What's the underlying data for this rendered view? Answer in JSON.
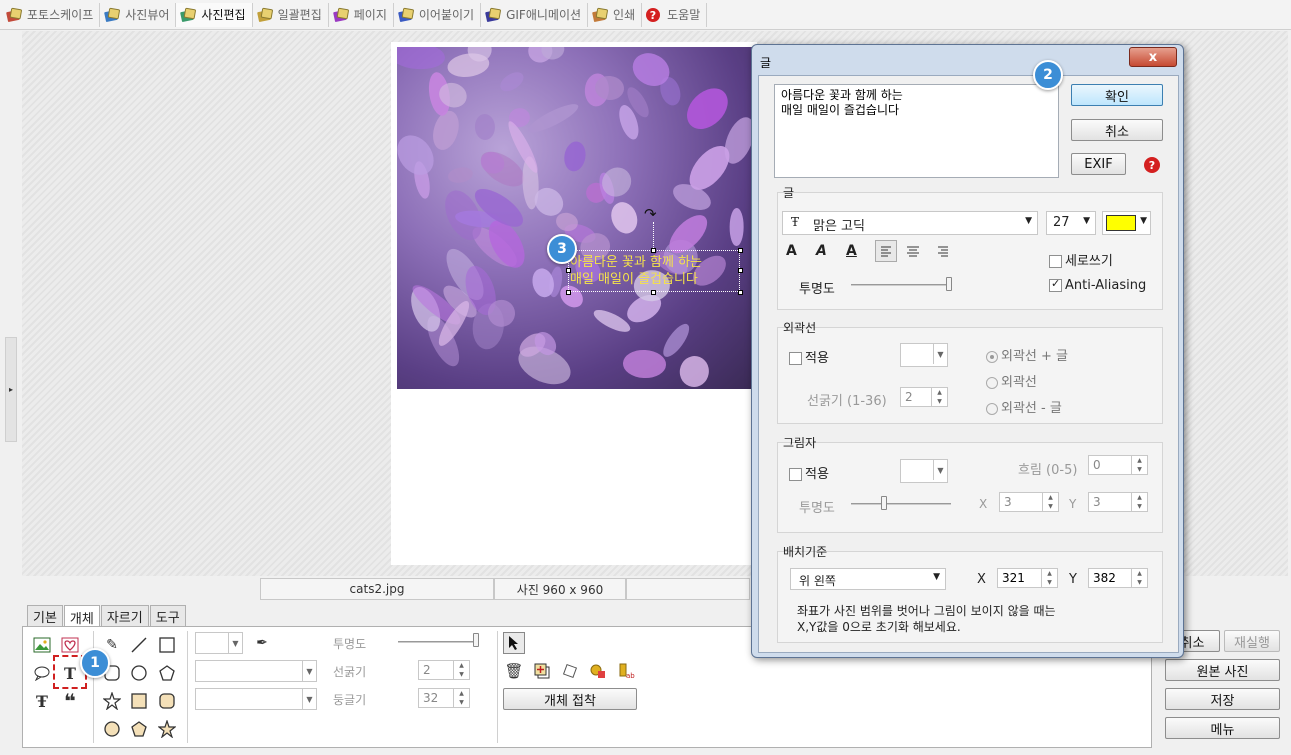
{
  "top_tabs": [
    {
      "label": "포토스케이프",
      "icon": "photoscape-icon",
      "color": "#c24a3a"
    },
    {
      "label": "사진뷰어",
      "icon": "viewer-icon",
      "color": "#3a7ac2"
    },
    {
      "label": "사진편집",
      "icon": "editor-icon",
      "color": "#3a9a6a"
    },
    {
      "label": "일괄편집",
      "icon": "batch-icon",
      "color": "#c2a03a"
    },
    {
      "label": "페이지",
      "icon": "page-icon",
      "color": "#9a3ac2"
    },
    {
      "label": "이어붙이기",
      "icon": "combine-icon",
      "color": "#3a5ac2"
    },
    {
      "label": "GIF애니메이션",
      "icon": "gif-icon",
      "color": "#3a3a9a"
    },
    {
      "label": "인쇄",
      "icon": "print-icon",
      "color": "#c27a3a"
    },
    {
      "label": "도움말",
      "icon": "help-icon",
      "color": "#d42020"
    }
  ],
  "active_top_tab": "사진편집",
  "photo": {
    "overlay_text": "아름다운 꽃과 함께 하는\n매일 매일이 즐겁습니다"
  },
  "badges": {
    "one": "1",
    "two": "2",
    "three": "3"
  },
  "status": {
    "filename": "cats2.jpg",
    "size": "사진 960 x 960"
  },
  "bottom_tabs": [
    "기본",
    "개체",
    "자르기",
    "도구"
  ],
  "bottom_panel": {
    "transparency_label": "투명도",
    "line_width_label": "선굵기",
    "line_width_value": "2",
    "roundness_label": "둥글기",
    "roundness_value": "32",
    "object_attach_button": "개체 접착"
  },
  "right_buttons": {
    "cancel": "취소",
    "redo": "재실행",
    "original": "원본 사진",
    "save": "저장",
    "menu": "메뉴"
  },
  "dialog": {
    "title": "글",
    "close": "x",
    "text_value": "아름다운 꽃과 함께 하는\n매일 매일이 즐겁습니다",
    "ok_button": "확인",
    "cancel_button": "취소",
    "exif_button": "EXIF",
    "text_section": {
      "title": "글",
      "font": "맑은 고딕",
      "size": "27",
      "color": "#ffff00",
      "vertical_label": "세로쓰기",
      "vertical_checked": false,
      "antialias_label": "Anti-Aliasing",
      "antialias_checked": true,
      "opacity_label": "투명도",
      "opacity_value": 1.0
    },
    "outline_section": {
      "title": "외곽선",
      "apply_label": "적용",
      "width_label": "선굵기 (1-36)",
      "width_value": "2",
      "radio1": "외곽선 + 글",
      "radio2": "외곽선",
      "radio3": "외곽선 - 글"
    },
    "shadow_section": {
      "title": "그림자",
      "apply_label": "적용",
      "blur_label": "흐림 (0-5)",
      "blur_value": "0",
      "opacity_label": "투명도",
      "x_label": "X",
      "x_value": "3",
      "y_label": "Y",
      "y_value": "3"
    },
    "placement_section": {
      "title": "배치기준",
      "anchor": "위 왼쪽",
      "x_label": "X",
      "x_value": "321",
      "y_label": "Y",
      "y_value": "382",
      "hint": "좌표가 사진 범위를 벗어나 그림이 보이지 않을 때는\nX,Y값을 0으로 초기화 해보세요."
    }
  }
}
